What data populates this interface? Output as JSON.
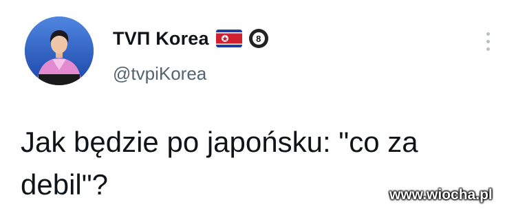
{
  "account": {
    "display_name": "ТVП Korea",
    "handle": "@tvpiKorea",
    "flag_icon": "north-korea-flag-icon",
    "badge_icon": "eight-ball-icon",
    "badge_text": "8"
  },
  "tweet": {
    "text": "Jak będzie po japońsku: \"co za debil\"?"
  },
  "watermark": {
    "text": "www.wiocha.pl"
  },
  "colors": {
    "text_primary": "#0f1419",
    "text_secondary": "#536471",
    "flag_blue": "#1d3e9e",
    "flag_red": "#d1202f"
  }
}
